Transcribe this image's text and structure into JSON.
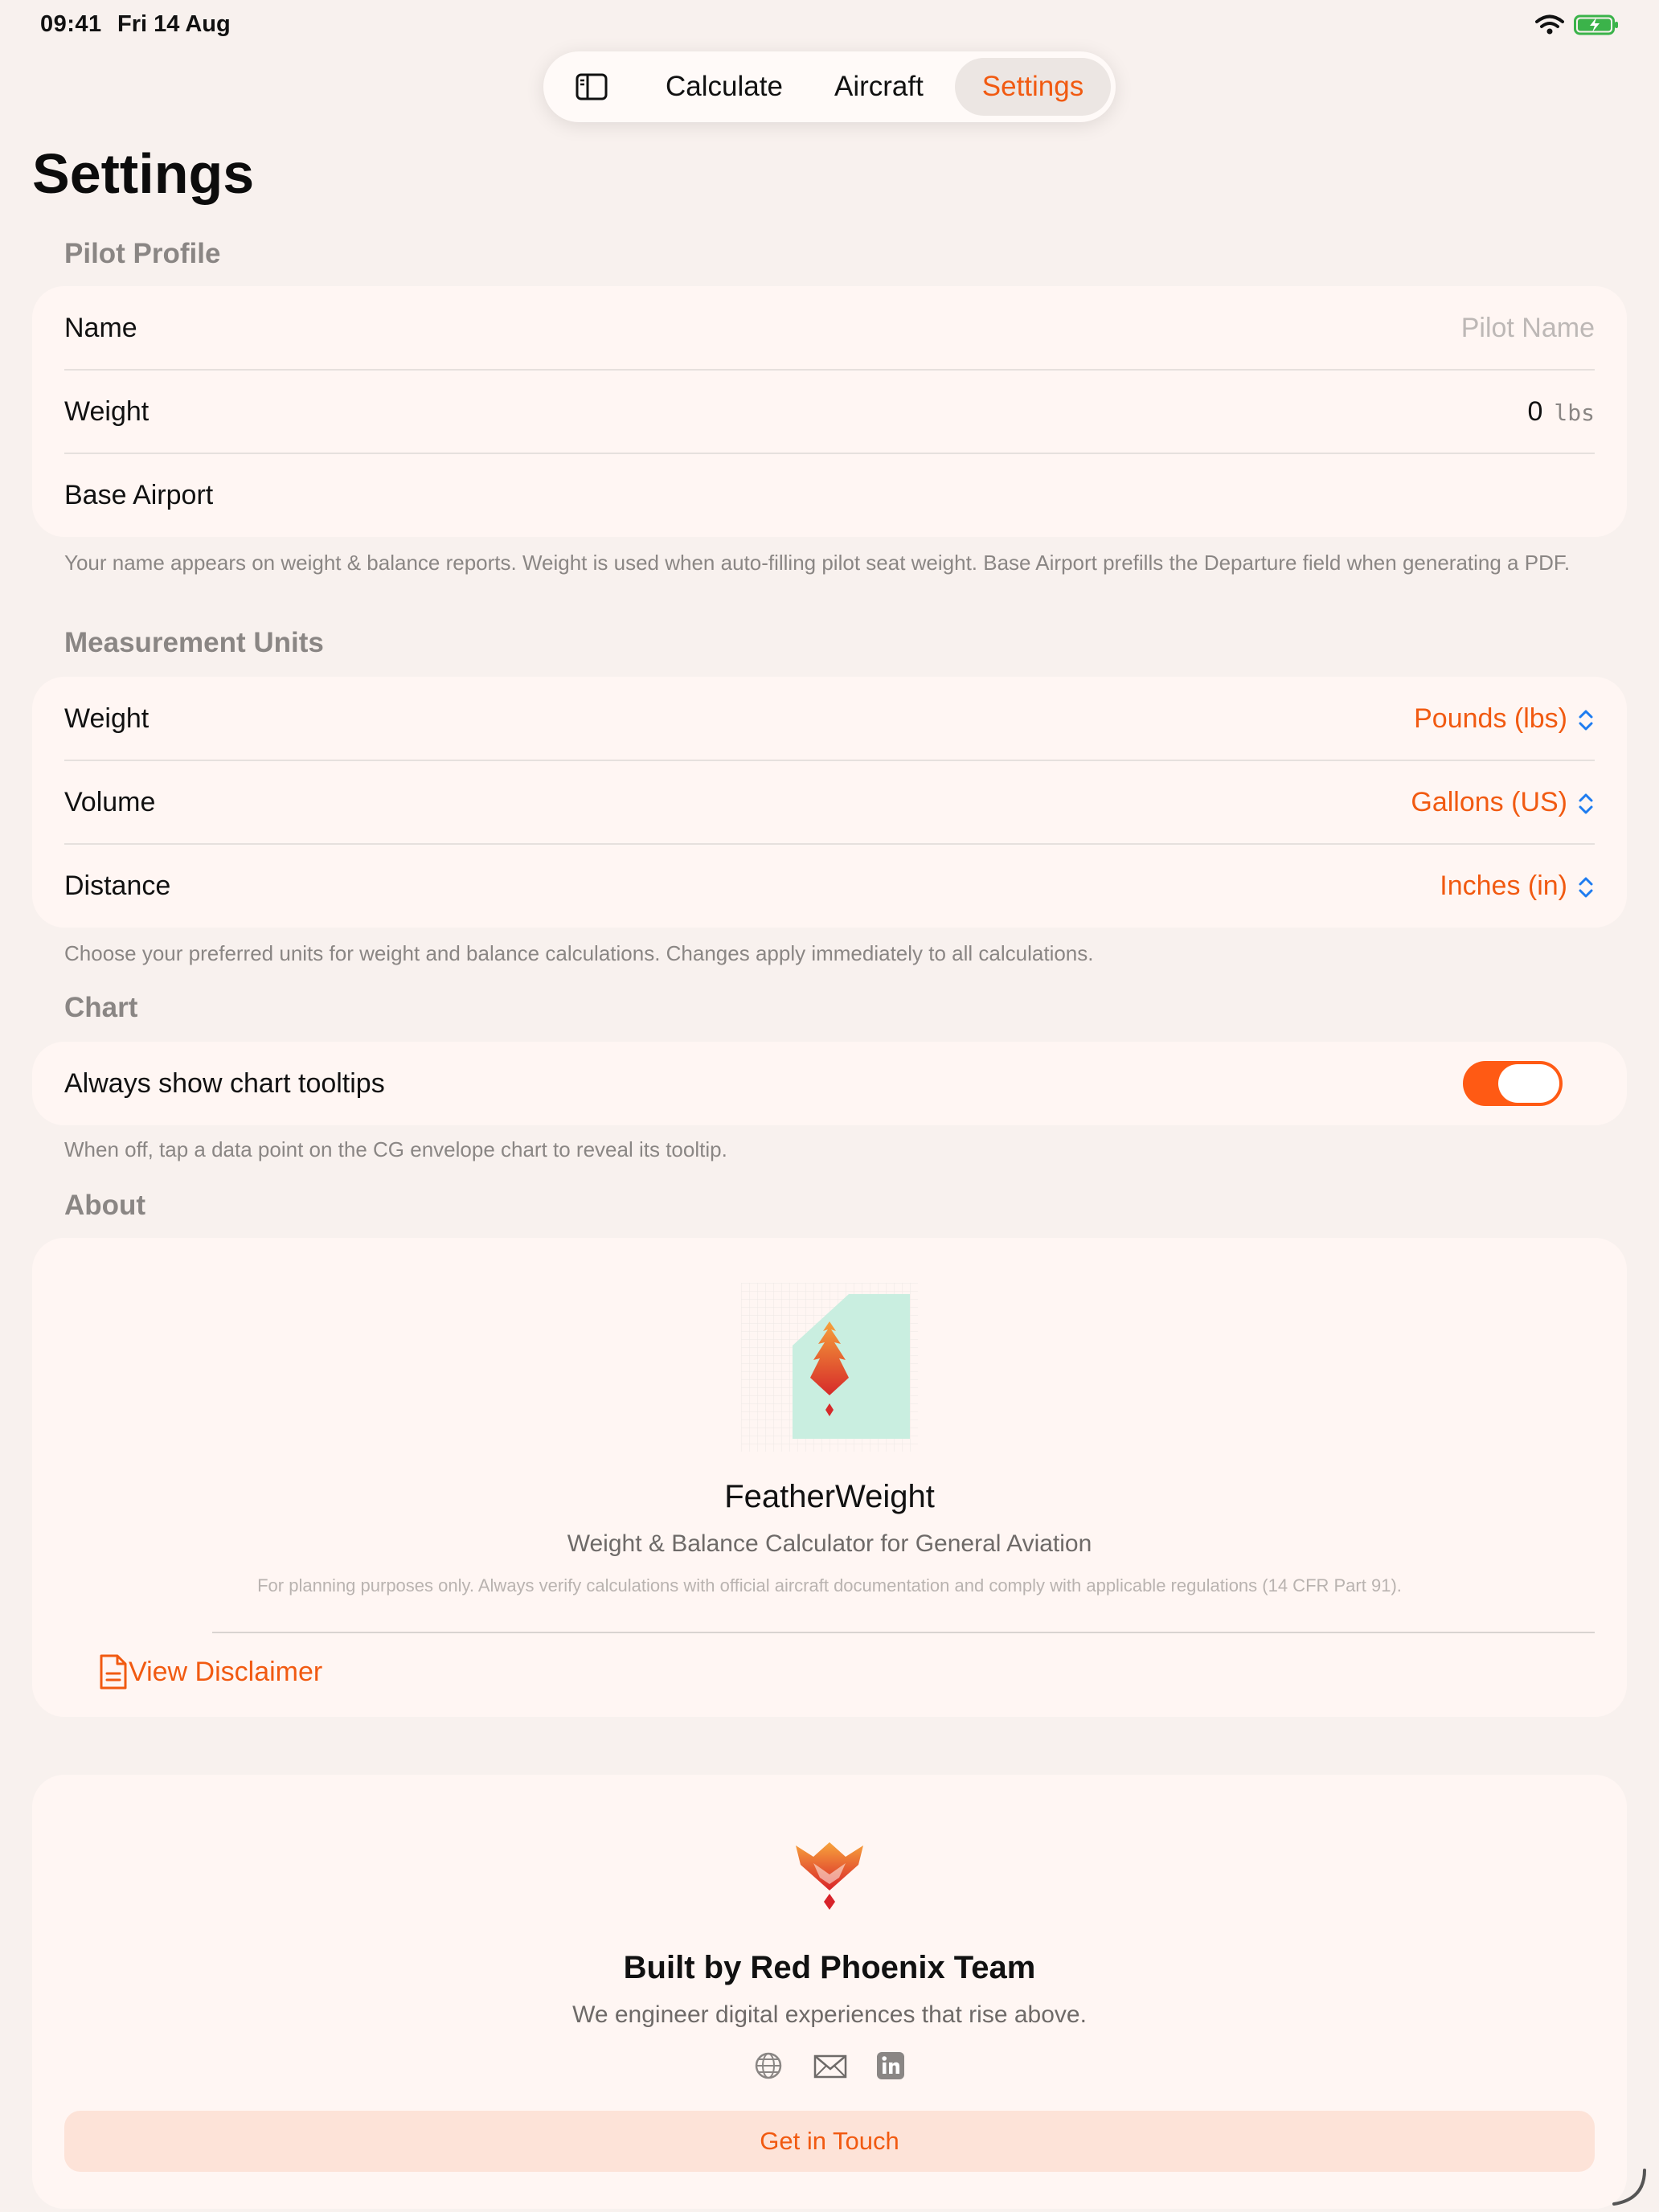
{
  "status_bar": {
    "time": "09:41",
    "date": "Fri 14 Aug"
  },
  "nav": {
    "tabs": [
      {
        "label": "Calculate"
      },
      {
        "label": "Aircraft"
      },
      {
        "label": "Settings",
        "active": true
      }
    ],
    "icons": {
      "sidebar": "sidebar-icon"
    }
  },
  "page": {
    "title": "Settings"
  },
  "pilot_profile": {
    "header": "Pilot Profile",
    "name": {
      "label": "Name",
      "placeholder": "Pilot Name",
      "value": ""
    },
    "weight": {
      "label": "Weight",
      "value": "0",
      "unit": "lbs"
    },
    "base_airport": {
      "label": "Base Airport",
      "value": ""
    },
    "footnote": "Your name appears on weight & balance reports. Weight is used when auto-filling pilot seat weight. Base Airport prefills the Departure field when generating a PDF."
  },
  "units": {
    "header": "Measurement Units",
    "weight": {
      "label": "Weight",
      "value": "Pounds (lbs)"
    },
    "volume": {
      "label": "Volume",
      "value": "Gallons (US)"
    },
    "distance": {
      "label": "Distance",
      "value": "Inches (in)"
    },
    "footnote": "Choose your preferred units for weight and balance calculations. Changes apply immediately to all calculations."
  },
  "chart": {
    "header": "Chart",
    "tooltips": {
      "label": "Always show chart tooltips",
      "on": true
    },
    "footnote": "When off, tap a data point on the CG envelope chart to reveal its tooltip."
  },
  "about": {
    "header": "About",
    "app_name": "FeatherWeight",
    "app_subtitle": "Weight & Balance Calculator for General Aviation",
    "legal": "For planning purposes only. Always verify calculations with official aircraft documentation and comply with applicable regulations (14 CFR Part 91).",
    "disclaimer_link": "View Disclaimer"
  },
  "team": {
    "name": "Built by Red Phoenix Team",
    "tagline": "We engineer digital experiences that rise above.",
    "cta": "Get in Touch",
    "social_icons": [
      "globe-icon",
      "mail-icon",
      "linkedin-icon"
    ]
  },
  "colors": {
    "accent": "#f15a11",
    "toggle_on": "#ff5a14",
    "background": "#f8f1ee",
    "card": "#fff6f3",
    "cta_bg": "#fde3d8"
  }
}
